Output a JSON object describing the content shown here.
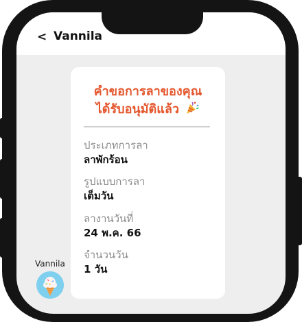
{
  "header": {
    "back_symbol": "<",
    "title": "Vannila"
  },
  "sender": {
    "name": "Vannila",
    "avatar_icon": "ice-cream-cone-icon"
  },
  "card": {
    "title_line1": "คำขอการลาของคุณ",
    "title_line2": "ได้รับอนุมัติแล้ว",
    "celebrate_icon": "party-popper-icon",
    "fields": [
      {
        "label": "ประเภทการลา",
        "value": "ลาพักร้อน"
      },
      {
        "label": "รูปแบบการลา",
        "value": "เต็มวัน"
      },
      {
        "label": "ลางานวันที่",
        "value": "24 พ.ค. 66"
      },
      {
        "label": "จำนวนวัน",
        "value": "1 วัน"
      }
    ]
  },
  "colors": {
    "accent": "#e4572e",
    "label": "#8c8c8c",
    "screen_bg": "#eeeeee",
    "frame": "#141414"
  }
}
